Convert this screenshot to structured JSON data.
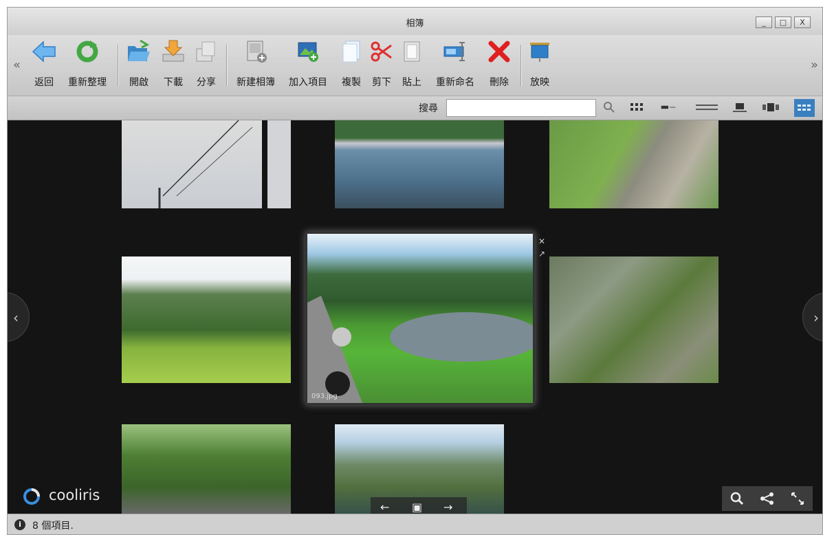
{
  "window": {
    "title": "相簿",
    "controls": [
      "_",
      "□",
      "X"
    ]
  },
  "toolbar": {
    "scroll_left": "«",
    "scroll_right": "»",
    "buttons": [
      {
        "label": "返回",
        "icon": "back-arrow-icon"
      },
      {
        "label": "重新整理",
        "icon": "refresh-icon"
      },
      {
        "label": "開啟",
        "icon": "open-folder-icon"
      },
      {
        "label": "下載",
        "icon": "download-icon"
      },
      {
        "label": "分享",
        "icon": "share-icon"
      },
      {
        "label": "新建相簿",
        "icon": "new-album-icon"
      },
      {
        "label": "加入項目",
        "icon": "add-item-icon"
      },
      {
        "label": "複製",
        "icon": "copy-icon"
      },
      {
        "label": "剪下",
        "icon": "cut-icon"
      },
      {
        "label": "貼上",
        "icon": "paste-icon"
      },
      {
        "label": "重新命名",
        "icon": "rename-icon"
      },
      {
        "label": "刪除",
        "icon": "delete-icon"
      },
      {
        "label": "放映",
        "icon": "slideshow-icon"
      }
    ]
  },
  "search": {
    "label": "搜尋",
    "value": "",
    "view_modes": [
      "grid-view-icon",
      "list-detail-view-icon",
      "list-view-icon",
      "single-view-icon",
      "coverflow-view-icon",
      "cooliris-wall-view-icon"
    ],
    "active_view": "cooliris-wall-view-icon"
  },
  "viewer": {
    "logo_text": "cooliris",
    "selected_filename": "093.jpg",
    "nav_prev": "‹",
    "nav_next": "›",
    "thumbnails": [
      "power-lines-photo",
      "lake-boats-photo",
      "garden-pond-photo",
      "hillside-lawn-photo",
      "lakeside-park-photo",
      "forest-trail-photo",
      "tree-canopy-photo",
      "lakeside-house-photo"
    ],
    "controls": [
      "zoom-icon",
      "share-icon",
      "fullscreen-icon"
    ]
  },
  "status": {
    "info_icon": "i",
    "text": "8 個項目."
  },
  "colors": {
    "viewer_bg": "#141414",
    "active_view": "#3a7fc0",
    "delete_red": "#e02020"
  }
}
